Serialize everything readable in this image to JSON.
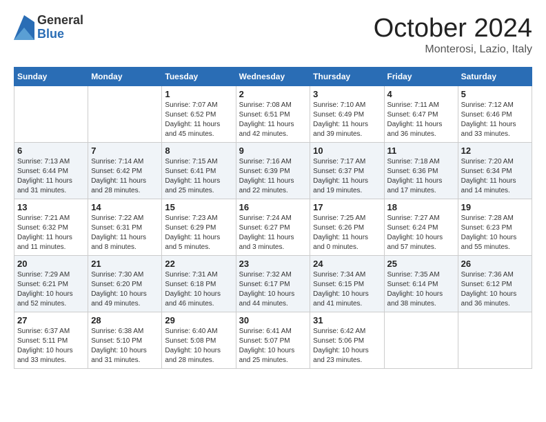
{
  "header": {
    "logo_general": "General",
    "logo_blue": "Blue",
    "month": "October 2024",
    "location": "Monterosi, Lazio, Italy"
  },
  "days_of_week": [
    "Sunday",
    "Monday",
    "Tuesday",
    "Wednesday",
    "Thursday",
    "Friday",
    "Saturday"
  ],
  "weeks": [
    [
      null,
      null,
      {
        "day": "1",
        "sunrise": "Sunrise: 7:07 AM",
        "sunset": "Sunset: 6:52 PM",
        "daylight": "Daylight: 11 hours and 45 minutes."
      },
      {
        "day": "2",
        "sunrise": "Sunrise: 7:08 AM",
        "sunset": "Sunset: 6:51 PM",
        "daylight": "Daylight: 11 hours and 42 minutes."
      },
      {
        "day": "3",
        "sunrise": "Sunrise: 7:10 AM",
        "sunset": "Sunset: 6:49 PM",
        "daylight": "Daylight: 11 hours and 39 minutes."
      },
      {
        "day": "4",
        "sunrise": "Sunrise: 7:11 AM",
        "sunset": "Sunset: 6:47 PM",
        "daylight": "Daylight: 11 hours and 36 minutes."
      },
      {
        "day": "5",
        "sunrise": "Sunrise: 7:12 AM",
        "sunset": "Sunset: 6:46 PM",
        "daylight": "Daylight: 11 hours and 33 minutes."
      }
    ],
    [
      {
        "day": "6",
        "sunrise": "Sunrise: 7:13 AM",
        "sunset": "Sunset: 6:44 PM",
        "daylight": "Daylight: 11 hours and 31 minutes."
      },
      {
        "day": "7",
        "sunrise": "Sunrise: 7:14 AM",
        "sunset": "Sunset: 6:42 PM",
        "daylight": "Daylight: 11 hours and 28 minutes."
      },
      {
        "day": "8",
        "sunrise": "Sunrise: 7:15 AM",
        "sunset": "Sunset: 6:41 PM",
        "daylight": "Daylight: 11 hours and 25 minutes."
      },
      {
        "day": "9",
        "sunrise": "Sunrise: 7:16 AM",
        "sunset": "Sunset: 6:39 PM",
        "daylight": "Daylight: 11 hours and 22 minutes."
      },
      {
        "day": "10",
        "sunrise": "Sunrise: 7:17 AM",
        "sunset": "Sunset: 6:37 PM",
        "daylight": "Daylight: 11 hours and 19 minutes."
      },
      {
        "day": "11",
        "sunrise": "Sunrise: 7:18 AM",
        "sunset": "Sunset: 6:36 PM",
        "daylight": "Daylight: 11 hours and 17 minutes."
      },
      {
        "day": "12",
        "sunrise": "Sunrise: 7:20 AM",
        "sunset": "Sunset: 6:34 PM",
        "daylight": "Daylight: 11 hours and 14 minutes."
      }
    ],
    [
      {
        "day": "13",
        "sunrise": "Sunrise: 7:21 AM",
        "sunset": "Sunset: 6:32 PM",
        "daylight": "Daylight: 11 hours and 11 minutes."
      },
      {
        "day": "14",
        "sunrise": "Sunrise: 7:22 AM",
        "sunset": "Sunset: 6:31 PM",
        "daylight": "Daylight: 11 hours and 8 minutes."
      },
      {
        "day": "15",
        "sunrise": "Sunrise: 7:23 AM",
        "sunset": "Sunset: 6:29 PM",
        "daylight": "Daylight: 11 hours and 5 minutes."
      },
      {
        "day": "16",
        "sunrise": "Sunrise: 7:24 AM",
        "sunset": "Sunset: 6:27 PM",
        "daylight": "Daylight: 11 hours and 3 minutes."
      },
      {
        "day": "17",
        "sunrise": "Sunrise: 7:25 AM",
        "sunset": "Sunset: 6:26 PM",
        "daylight": "Daylight: 11 hours and 0 minutes."
      },
      {
        "day": "18",
        "sunrise": "Sunrise: 7:27 AM",
        "sunset": "Sunset: 6:24 PM",
        "daylight": "Daylight: 10 hours and 57 minutes."
      },
      {
        "day": "19",
        "sunrise": "Sunrise: 7:28 AM",
        "sunset": "Sunset: 6:23 PM",
        "daylight": "Daylight: 10 hours and 55 minutes."
      }
    ],
    [
      {
        "day": "20",
        "sunrise": "Sunrise: 7:29 AM",
        "sunset": "Sunset: 6:21 PM",
        "daylight": "Daylight: 10 hours and 52 minutes."
      },
      {
        "day": "21",
        "sunrise": "Sunrise: 7:30 AM",
        "sunset": "Sunset: 6:20 PM",
        "daylight": "Daylight: 10 hours and 49 minutes."
      },
      {
        "day": "22",
        "sunrise": "Sunrise: 7:31 AM",
        "sunset": "Sunset: 6:18 PM",
        "daylight": "Daylight: 10 hours and 46 minutes."
      },
      {
        "day": "23",
        "sunrise": "Sunrise: 7:32 AM",
        "sunset": "Sunset: 6:17 PM",
        "daylight": "Daylight: 10 hours and 44 minutes."
      },
      {
        "day": "24",
        "sunrise": "Sunrise: 7:34 AM",
        "sunset": "Sunset: 6:15 PM",
        "daylight": "Daylight: 10 hours and 41 minutes."
      },
      {
        "day": "25",
        "sunrise": "Sunrise: 7:35 AM",
        "sunset": "Sunset: 6:14 PM",
        "daylight": "Daylight: 10 hours and 38 minutes."
      },
      {
        "day": "26",
        "sunrise": "Sunrise: 7:36 AM",
        "sunset": "Sunset: 6:12 PM",
        "daylight": "Daylight: 10 hours and 36 minutes."
      }
    ],
    [
      {
        "day": "27",
        "sunrise": "Sunrise: 6:37 AM",
        "sunset": "Sunset: 5:11 PM",
        "daylight": "Daylight: 10 hours and 33 minutes."
      },
      {
        "day": "28",
        "sunrise": "Sunrise: 6:38 AM",
        "sunset": "Sunset: 5:10 PM",
        "daylight": "Daylight: 10 hours and 31 minutes."
      },
      {
        "day": "29",
        "sunrise": "Sunrise: 6:40 AM",
        "sunset": "Sunset: 5:08 PM",
        "daylight": "Daylight: 10 hours and 28 minutes."
      },
      {
        "day": "30",
        "sunrise": "Sunrise: 6:41 AM",
        "sunset": "Sunset: 5:07 PM",
        "daylight": "Daylight: 10 hours and 25 minutes."
      },
      {
        "day": "31",
        "sunrise": "Sunrise: 6:42 AM",
        "sunset": "Sunset: 5:06 PM",
        "daylight": "Daylight: 10 hours and 23 minutes."
      },
      null,
      null
    ]
  ]
}
